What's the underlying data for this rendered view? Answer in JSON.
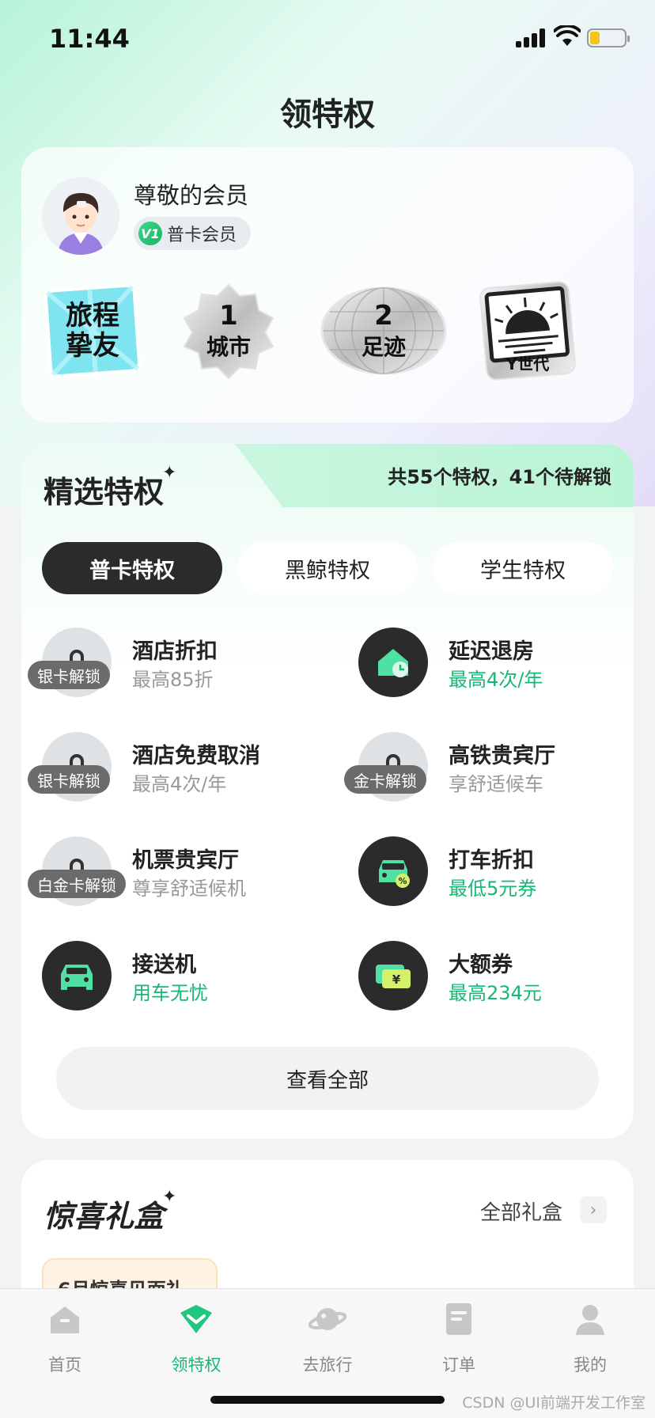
{
  "status_bar": {
    "time": "11:44"
  },
  "page_title": "领特权",
  "member": {
    "name": "尊敬的会员",
    "level_badge": "V1",
    "level_name": "普卡会员",
    "badges": [
      {
        "line1": "旅程",
        "line2": "挚友"
      },
      {
        "line1": "1",
        "line2": "城市"
      },
      {
        "line1": "2",
        "line2": "足迹"
      },
      {
        "line1": "Y世代"
      }
    ]
  },
  "privileges": {
    "title": "精选特权",
    "count_text": "共55个特权，41个待解锁",
    "tabs": [
      {
        "label": "普卡特权",
        "active": true
      },
      {
        "label": "黑鲸特权",
        "active": false
      },
      {
        "label": "学生特权",
        "active": false
      }
    ],
    "items": [
      {
        "name": "酒店折扣",
        "desc": "最高85折",
        "lock": "银卡解锁"
      },
      {
        "name": "延迟退房",
        "desc": "最高4次/年"
      },
      {
        "name": "酒店免费取消",
        "desc": "最高4次/年",
        "lock": "银卡解锁"
      },
      {
        "name": "高铁贵宾厅",
        "desc": "享舒适候车",
        "lock": "金卡解锁"
      },
      {
        "name": "机票贵宾厅",
        "desc": "尊享舒适候机",
        "lock": "白金卡解锁"
      },
      {
        "name": "打车折扣",
        "desc": "最低5元券"
      },
      {
        "name": "接送机",
        "desc": "用车无忧"
      },
      {
        "name": "大额券",
        "desc": "最高234元"
      }
    ],
    "view_all": "查看全部",
    "accent": "#16b874"
  },
  "gifts": {
    "title": "惊喜礼盒",
    "all_label": "全部礼盒",
    "card_title": "6月惊喜见面礼"
  },
  "tab_bar": [
    {
      "label": "首页",
      "icon": "home-icon"
    },
    {
      "label": "领特权",
      "icon": "privilege-icon",
      "active": true
    },
    {
      "label": "去旅行",
      "icon": "planet-icon"
    },
    {
      "label": "订单",
      "icon": "order-icon"
    },
    {
      "label": "我的",
      "icon": "profile-icon"
    }
  ],
  "watermark_credit": "CSDN @UI前端开发工作室"
}
